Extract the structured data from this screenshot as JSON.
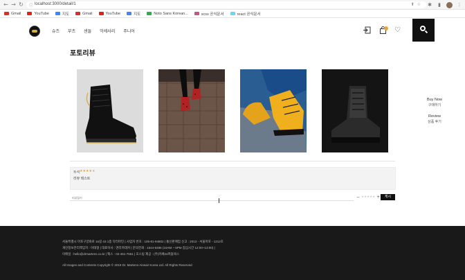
{
  "browser": {
    "url": "localhost:3000/detail/1",
    "bookmarks": [
      {
        "label": "Gmail",
        "color": "#d93025"
      },
      {
        "label": "YouTube",
        "color": "#e62117"
      },
      {
        "label": "지도",
        "color": "#4285f4"
      },
      {
        "label": "Gmail",
        "color": "#d93025"
      },
      {
        "label": "YouTube",
        "color": "#e62117"
      },
      {
        "label": "지도",
        "color": "#4285f4"
      },
      {
        "label": "Noto Sans Korean...",
        "color": "#34a853"
      },
      {
        "label": "scss 공식문서",
        "color": "#c6538c"
      },
      {
        "label": "react 공식문서",
        "color": "#61dafb"
      }
    ]
  },
  "header": {
    "nav": [
      "슈즈",
      "부츠",
      "샌들",
      "악세사리",
      "주니어"
    ]
  },
  "page": {
    "title": "포토리뷰"
  },
  "side_links": {
    "buy_title": "Buy Now",
    "buy_sub": "구매하기",
    "review_title": "Review",
    "review_sub": "상품 후기"
  },
  "review": {
    "user": "두석",
    "stars": "★★★★★",
    "rating": 4,
    "text": "리뷰 테스트"
  },
  "comment": {
    "placeholder": "리뷰달기",
    "rating_minus": "−",
    "rating_stars": "★★★★★",
    "rating_plus": "+",
    "submit": "게시"
  },
  "footer": {
    "line1": "서울특별시 마포구양화로 16길 43 1층 닥터마틴   |   사업자 번호 : 105-81-94802   |   통신판매업 신고 : 2013 - 서울마포 - 1212호",
    "line2": "개인정보관리책임자 : 이태형   |   대표이사 : 엔라카데커   |   문의전화 : 1544-6486 (10AM ~ 5PM 점심시간 12:00~13:00)   |",
    "line3": "이메일 : hello@drmartens.co.kr   |   팩스 : 02-451-7651   |   호스팅 제공 : (주)카페24퍼블렉스",
    "copyright": "All Images and Contents Copyright © 2019 Dr. Martens-Airwair Korea Ltd. All Rights Reserved"
  }
}
